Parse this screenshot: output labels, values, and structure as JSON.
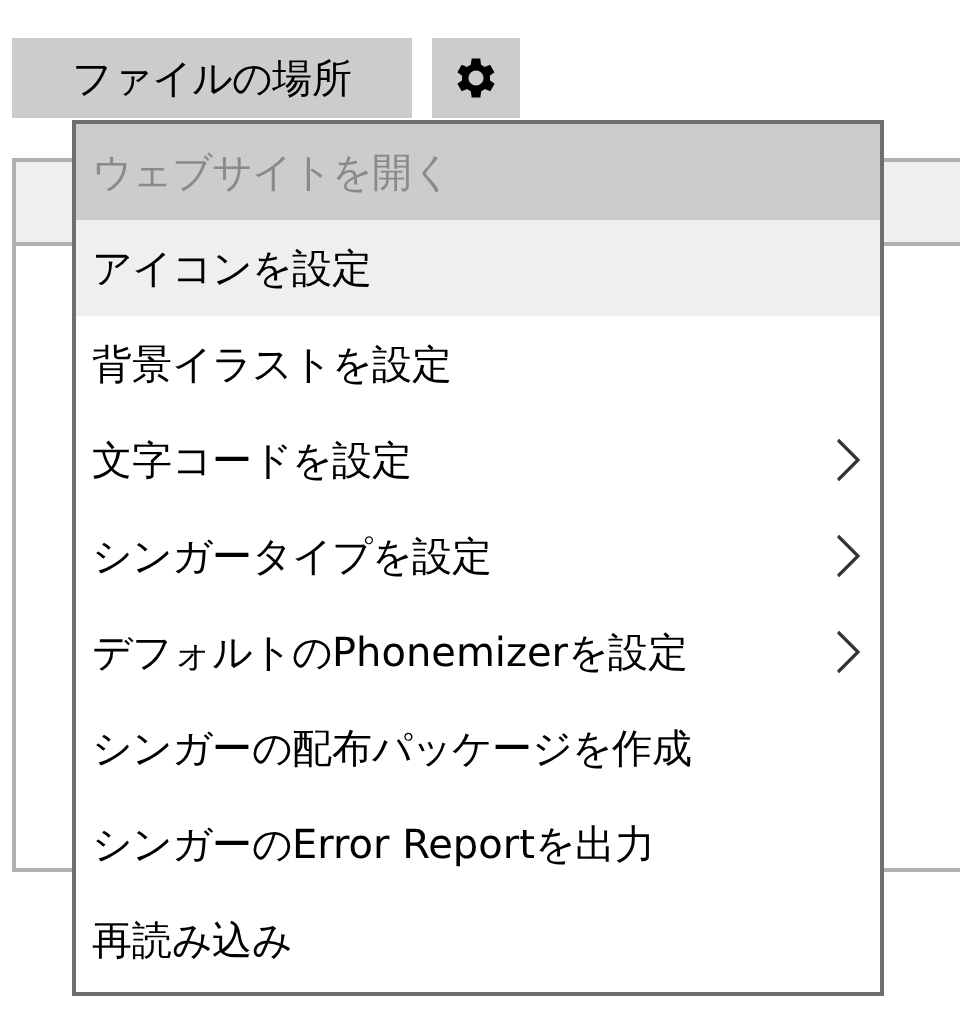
{
  "toolbar": {
    "location_button": "ファイルの場所",
    "settings_button": {
      "kind": "gear"
    }
  },
  "menu": {
    "items": [
      {
        "label": "ウェブサイトを開く",
        "disabled": true,
        "highlighted": false,
        "submenu": false
      },
      {
        "label": "アイコンを設定",
        "disabled": false,
        "highlighted": true,
        "submenu": false
      },
      {
        "label": "背景イラストを設定",
        "disabled": false,
        "highlighted": false,
        "submenu": false
      },
      {
        "label": "文字コードを設定",
        "disabled": false,
        "highlighted": false,
        "submenu": true
      },
      {
        "label": "シンガータイプを設定",
        "disabled": false,
        "highlighted": false,
        "submenu": true
      },
      {
        "label": "デフォルトのPhonemizerを設定",
        "disabled": false,
        "highlighted": false,
        "submenu": true
      },
      {
        "label": "シンガーの配布パッケージを作成",
        "disabled": false,
        "highlighted": false,
        "submenu": false
      },
      {
        "label": "シンガーのError Reportを出力",
        "disabled": false,
        "highlighted": false,
        "submenu": false
      },
      {
        "label": "再読み込み",
        "disabled": false,
        "highlighted": false,
        "submenu": false
      }
    ]
  }
}
